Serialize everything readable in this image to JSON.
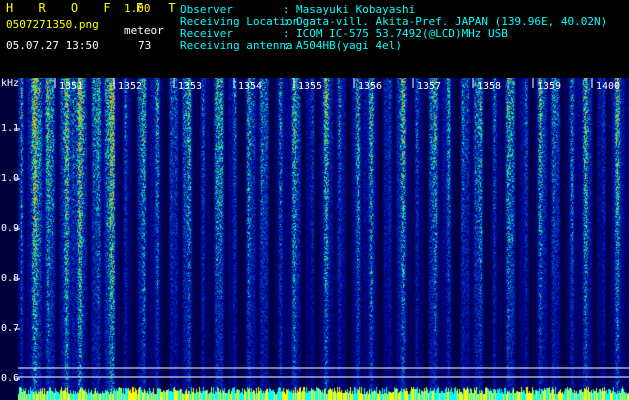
{
  "header": {
    "brand": "H R O F F T",
    "version": "1.00",
    "filename": "0507271350.png",
    "mode": "meteor",
    "count": "73",
    "datetime": "05.07.27 13:50",
    "info": [
      {
        "label": "Observer",
        "value": "Masayuki Kobayashi"
      },
      {
        "label": "Receiving Location",
        "value": "Ogata-vill. Akita-Pref. JAPAN (139.96E, 40.02N)"
      },
      {
        "label": "Receiver",
        "value": "ICOM IC-575 53.7492(@LCD)MHz USB"
      },
      {
        "label": "Receiving antenna",
        "value": "A504HB(yagi 4el)"
      }
    ]
  },
  "plot": {
    "yunit": "kHz",
    "yticks": [
      "1.1",
      "1.0",
      "0.9",
      "0.8",
      "0.7",
      "0.6"
    ],
    "minutes": [
      "1351",
      "1352",
      "1353",
      "1354",
      "1355",
      "1356",
      "1357",
      "1358",
      "1359",
      "1400"
    ]
  },
  "colors": {
    "background": "#000000",
    "header_text": "#ffff00",
    "label_text": "#00ffff",
    "scale_text": "#ffffff",
    "spectrum_low": "#0a1a6e",
    "spectrum_high": "#00ff80"
  }
}
